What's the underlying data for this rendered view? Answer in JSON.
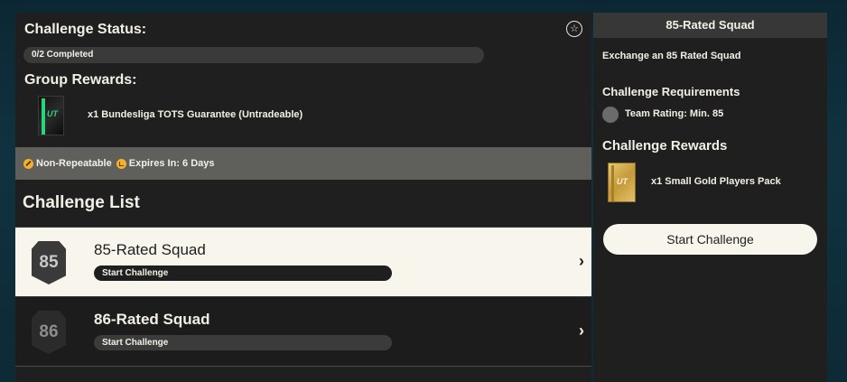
{
  "status": {
    "title": "Challenge Status:",
    "star_icon": "star-circle-icon",
    "progress_text": "0/2 Completed",
    "progress_fraction": 0
  },
  "group_rewards": {
    "title": "Group Rewards:",
    "item_text": "x1 Bundesliga TOTS Guarantee (Untradeable)",
    "pack_logo": "UT"
  },
  "info_bar": {
    "non_repeatable": "Non-Repeatable",
    "expires": "Expires In: 6 Days"
  },
  "challenge_list": {
    "title": "Challenge List",
    "rows": [
      {
        "rating": "85",
        "title": "85-Rated Squad",
        "button": "Start Challenge",
        "selected": true
      },
      {
        "rating": "86",
        "title": "86-Rated Squad",
        "button": "Start Challenge",
        "selected": false
      }
    ]
  },
  "detail": {
    "header": "85-Rated Squad",
    "description": "Exchange an 85 Rated Squad",
    "requirements_title": "Challenge Requirements",
    "requirement": "Team Rating: Min. 85",
    "rewards_title": "Challenge Rewards",
    "reward": "x1 Small Gold Players Pack",
    "pack_logo": "UT",
    "start_button": "Start Challenge"
  },
  "colors": {
    "panel": "#1f1f1f",
    "selected_row": "#f7f5ec",
    "info_bar": "#5f5f5c",
    "icon_accent": "#f5b12b",
    "tots_green": "#29d47a",
    "gold": "#c49a3a"
  }
}
